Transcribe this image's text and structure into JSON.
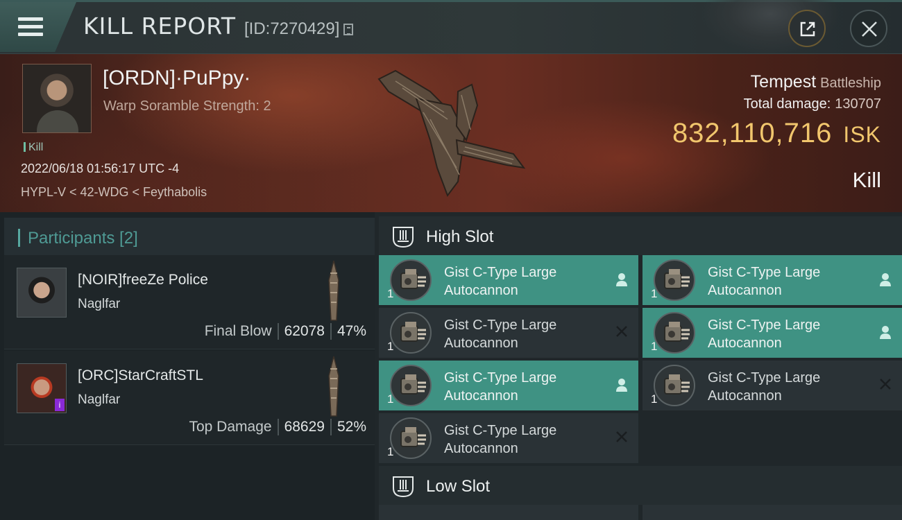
{
  "header": {
    "title": "KILL REPORT",
    "report_id": "[ID:7270429]"
  },
  "victim": {
    "name": "[ORDN]·PuPpy·",
    "warp_strength": "Warp Soramble Strength: 2",
    "kill_tag": "Kill",
    "timestamp": "2022/06/18 01:56:17 UTC -4",
    "location": "HYPL-V < 42-WDG < Feythabolis",
    "ship_name": "Tempest",
    "ship_class": "Battleship",
    "total_damage_label": "Total damage:",
    "total_damage": "130707",
    "isk_value": "832,110,716",
    "isk_unit": "ISK",
    "result": "Kill"
  },
  "participants": {
    "label": "Participants [2]",
    "rows": [
      {
        "name": "[NOIR]freeZe Police",
        "ship": "Naglfar",
        "role": "Final Blow",
        "damage": "62078",
        "percent": "47%"
      },
      {
        "name": "[ORC]StarCraftSTL",
        "ship": "Naglfar",
        "role": "Top Damage",
        "damage": "68629",
        "percent": "52%"
      }
    ]
  },
  "fitting": {
    "high_slot_label": "High Slot",
    "low_slot_label": "Low Slot",
    "modules": [
      {
        "line1": "Gist C-Type Large",
        "line2": "Autocannon",
        "qty": "1",
        "status": "pilot-icon"
      },
      {
        "line1": "Gist C-Type Large",
        "line2": "Autocannon",
        "qty": "1",
        "status": "pilot-icon"
      },
      {
        "line1": "Gist C-Type Large",
        "line2": "Autocannon",
        "qty": "1",
        "status": "destroyed-x-icon"
      },
      {
        "line1": "Gist C-Type Large",
        "line2": "Autocannon",
        "qty": "1",
        "status": "pilot-icon"
      },
      {
        "line1": "Gist C-Type Large",
        "line2": "Autocannon",
        "qty": "1",
        "status": "pilot-icon"
      },
      {
        "line1": "Gist C-Type Large",
        "line2": "Autocannon",
        "qty": "1",
        "status": "destroyed-x-icon"
      },
      {
        "line1": "Gist C-Type Large",
        "line2": "Autocannon",
        "qty": "1",
        "status": "destroyed-x-icon"
      }
    ]
  },
  "colors": {
    "accent_teal": "#3f9283",
    "isk_gold": "#f1c66d",
    "participants_label": "#4f9b95"
  }
}
